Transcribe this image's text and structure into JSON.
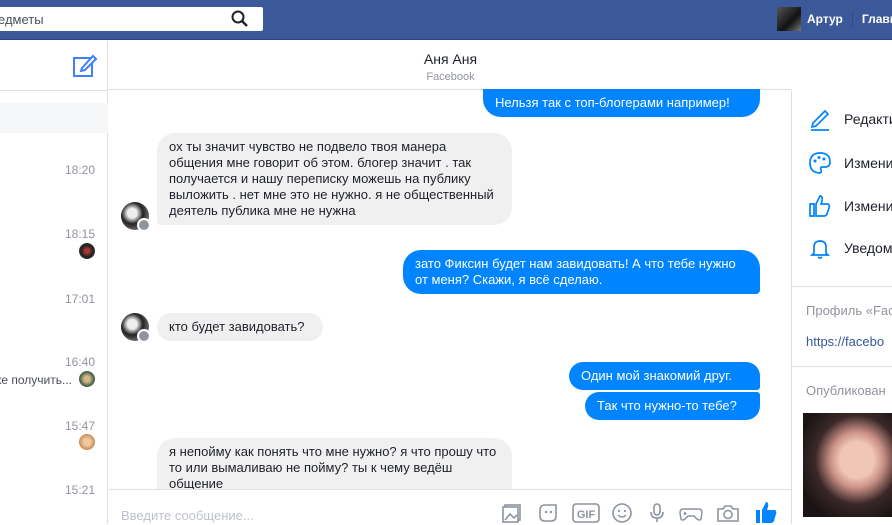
{
  "topbar": {
    "search_text": "едметы",
    "profile_name": "Артур",
    "home_label": "Главн"
  },
  "left": {
    "times": [
      "18:20",
      "18:15",
      "17:01",
      "16:40",
      "15:47",
      "15:21"
    ],
    "snippet": "ке получить..."
  },
  "chat": {
    "name": "Аня Аня",
    "subtitle": "Facebook",
    "messages": [
      {
        "from": "me",
        "text": "Нельзя так с топ-блогерами например!"
      },
      {
        "from": "them",
        "text": "ох ты значит чувство не подвело твоя манера общения мне говорит об этом. блогер значит . так получается и нашу переписку можешь на публику выложить . нет мне это не нужно. я не общественный деятель публика мне не нужна"
      },
      {
        "from": "me",
        "text": "зато Фиксин будет нам завидовать! А что тебе нужно от меня? Скажи, я всё сделаю."
      },
      {
        "from": "them",
        "text": "кто будет завидовать?"
      },
      {
        "from": "me",
        "text": "Один мой знакомий друг."
      },
      {
        "from": "me",
        "text": "Так что нужно-то тебе?"
      },
      {
        "from": "them",
        "text": "я непойму как понять что мне нужно? я что прошу что то или вымаливаю не пойму? ты к чему ведёш общение"
      }
    ],
    "input_placeholder": "Введите сообщение..."
  },
  "right": {
    "options": [
      "Редакти",
      "Измени",
      "Измени",
      "Уведом"
    ],
    "profile_label": "Профиль «Fac",
    "profile_link": "https://facebo",
    "published_label": "Опубликован"
  },
  "colors": {
    "brand": "#3b5998",
    "accent": "#0084ff",
    "bubble_in": "#f1f0f0"
  }
}
